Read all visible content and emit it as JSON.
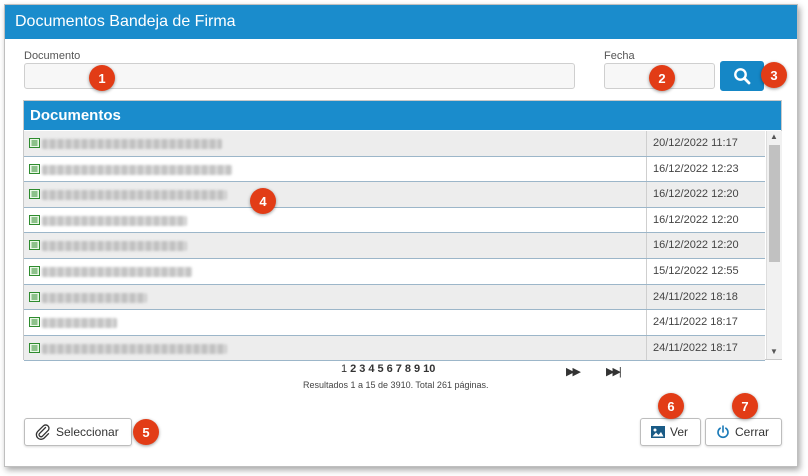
{
  "window": {
    "title": "Documentos Bandeja de Firma"
  },
  "filters": {
    "documento_label": "Documento",
    "documento_value": "",
    "fecha_label": "Fecha",
    "fecha_value": "",
    "search_icon": "search-icon"
  },
  "panel": {
    "title": "Documentos"
  },
  "rows": [
    {
      "date": "20/12/2022 11:17"
    },
    {
      "date": "16/12/2022 12:23"
    },
    {
      "date": "16/12/2022 12:20"
    },
    {
      "date": "16/12/2022 12:20"
    },
    {
      "date": "16/12/2022 12:20"
    },
    {
      "date": "15/12/2022 12:55"
    },
    {
      "date": "24/11/2022 18:18"
    },
    {
      "date": "24/11/2022 18:17"
    },
    {
      "date": "24/11/2022 18:17"
    }
  ],
  "pagination": {
    "pages": [
      "1",
      "2",
      "3",
      "4",
      "5",
      "6",
      "7",
      "8",
      "9",
      "10"
    ],
    "current_page": 1,
    "results": "Resultados 1 a 15 de 3910. Total 261 páginas."
  },
  "buttons": {
    "seleccionar": "Seleccionar",
    "ver": "Ver",
    "cerrar": "Cerrar"
  },
  "badges": [
    "1",
    "2",
    "3",
    "4",
    "5",
    "6",
    "7"
  ],
  "colors": {
    "accent": "#1a8ccc",
    "badge": "#e23c16"
  }
}
